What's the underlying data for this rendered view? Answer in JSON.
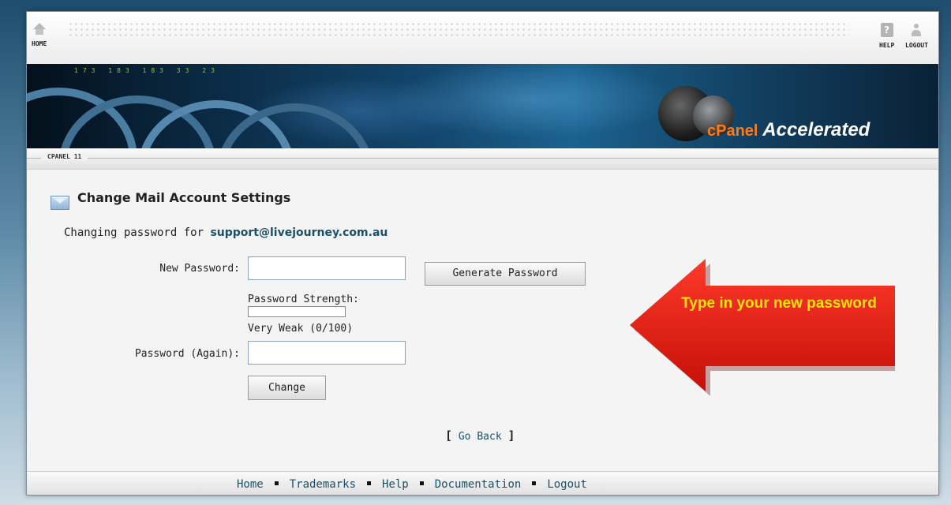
{
  "topbar": {
    "home_label": "HOME",
    "help_label": "HELP",
    "logout_label": "LOGOUT"
  },
  "banner": {
    "logo_brand": "cPanel",
    "logo_suffix": "Accelerated",
    "digits": "173 183 183 33 23"
  },
  "tab": {
    "label": "CPANEL 11"
  },
  "page": {
    "title": "Change Mail Account Settings",
    "changing_prefix": "Changing password for ",
    "email": "support@livejourney.com.au"
  },
  "form": {
    "new_password_label": "New Password:",
    "generate_button": "Generate Password",
    "strength_label": "Password Strength:",
    "strength_text": "Very Weak (0/100)",
    "strength_value": 0,
    "password_again_label": "Password (Again):",
    "change_button": "Change",
    "new_password_value": "",
    "password_again_value": ""
  },
  "go_back": {
    "open": "[",
    "label": "Go Back",
    "close": "]"
  },
  "callout": {
    "text": "Type in your new password",
    "color": "#e41e10",
    "text_color": "#ffe600"
  },
  "footer": {
    "links": [
      "Home",
      "Trademarks",
      "Help",
      "Documentation",
      "Logout"
    ]
  }
}
